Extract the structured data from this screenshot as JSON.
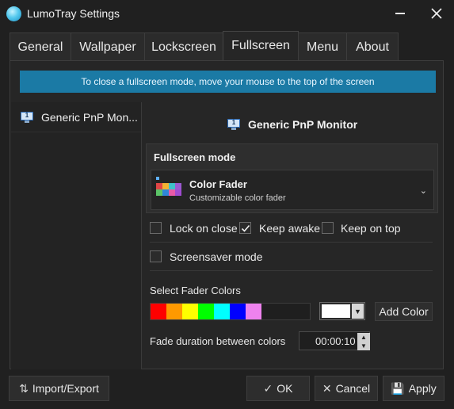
{
  "window": {
    "title": "LumoTray Settings"
  },
  "tabs": [
    {
      "label": "General"
    },
    {
      "label": "Wallpaper"
    },
    {
      "label": "Lockscreen"
    },
    {
      "label": "Fullscreen",
      "active": true
    },
    {
      "label": "Menu"
    },
    {
      "label": "About"
    }
  ],
  "banner": {
    "text": "To close a fullscreen mode, move your mouse to the top of the screen"
  },
  "monitors": {
    "items": [
      {
        "label": "Generic PnP Mon...",
        "number": "1"
      }
    ],
    "selected_title": "Generic PnP Monitor",
    "selected_number": "1"
  },
  "fullscreen_mode": {
    "group_title": "Fullscreen mode",
    "selected_name": "Color Fader",
    "selected_desc": "Customizable color fader"
  },
  "options": {
    "lock_on_close": {
      "label": "Lock on close",
      "checked": false
    },
    "keep_awake": {
      "label": "Keep awake",
      "checked": true
    },
    "keep_on_top": {
      "label": "Keep on top",
      "checked": false
    },
    "screensaver_mode": {
      "label": "Screensaver mode",
      "checked": false
    }
  },
  "fader": {
    "title": "Select Fader Colors",
    "colors": [
      "#ff0000",
      "#ff9900",
      "#ffff00",
      "#00ff00",
      "#00ffff",
      "#0000ff",
      "#ee82ee"
    ],
    "picker_color": "#ffffff",
    "add_label": "Add Color",
    "duration_label": "Fade duration between colors",
    "duration_value": "00:00:10"
  },
  "footer": {
    "import_export": "Import/Export",
    "ok": "OK",
    "cancel": "Cancel",
    "apply": "Apply"
  },
  "colors": {
    "banner": "#1b7aa5",
    "background": "#202020",
    "panel": "#262626"
  }
}
